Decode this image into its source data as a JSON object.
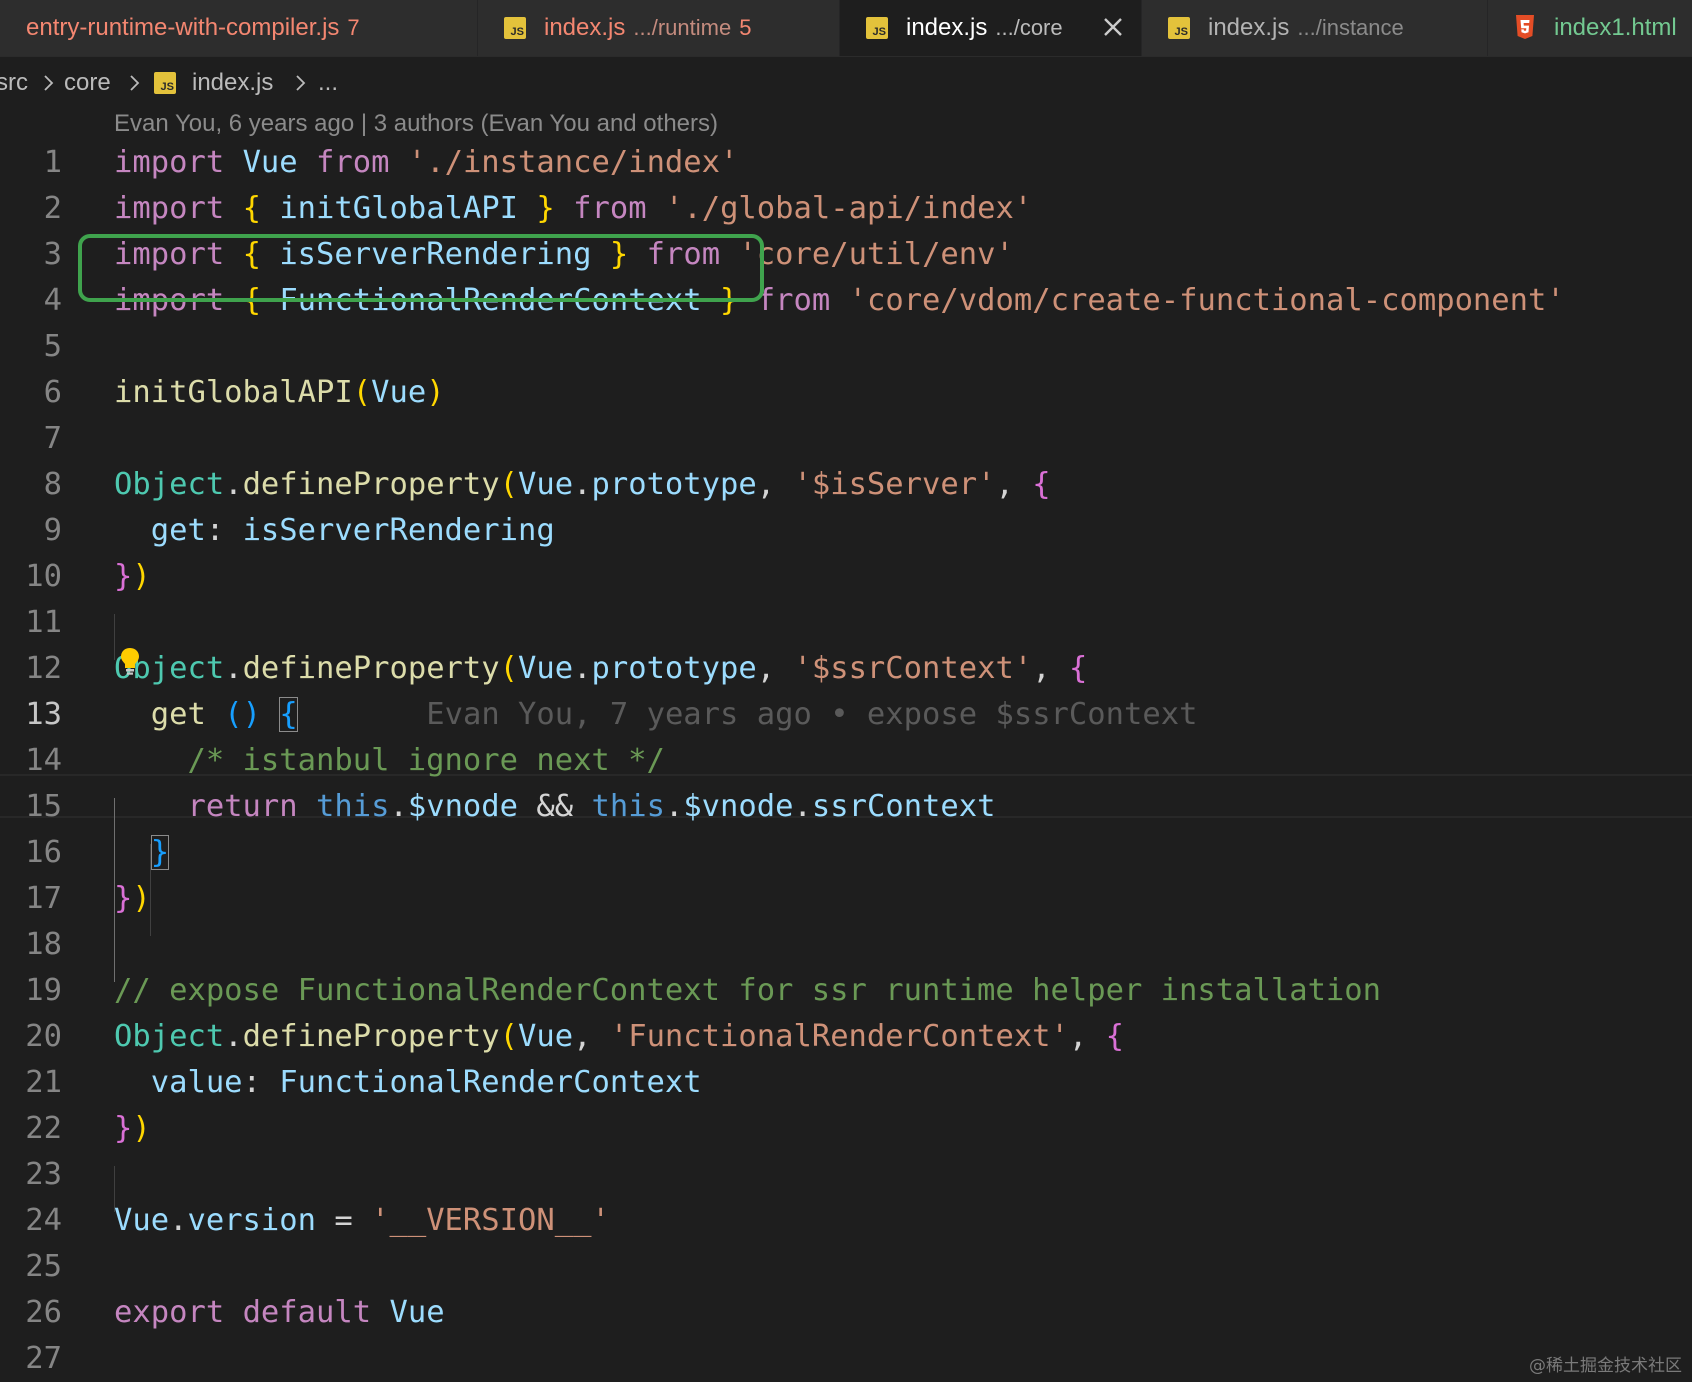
{
  "tabs": [
    {
      "label": "entry-runtime-with-compiler.js",
      "count": "7",
      "icon": "js-file-icon",
      "state": "error"
    },
    {
      "label": "index.js",
      "description": ".../runtime",
      "count": "5",
      "icon": "js-file-icon",
      "state": "error"
    },
    {
      "label": "index.js",
      "description": ".../core",
      "icon": "js-file-icon",
      "state": "active",
      "close": "close-icon"
    },
    {
      "label": "index.js",
      "description": ".../instance",
      "icon": "js-file-icon",
      "state": "normal"
    },
    {
      "label": "index1.html",
      "icon": "html5-file-icon",
      "state": "html"
    }
  ],
  "js_icon_text": "JS",
  "breadcrumb": {
    "items": [
      "src",
      "core",
      "index.js",
      "..."
    ]
  },
  "blame": {
    "top": "Evan You, 6 years ago | 3 authors (Evan You and others)",
    "inline": "Evan You, 7 years ago • expose $ssrContext"
  },
  "editor": {
    "current_line": 13,
    "line_numbers": [
      "1",
      "2",
      "3",
      "4",
      "5",
      "6",
      "7",
      "8",
      "9",
      "10",
      "11",
      "12",
      "13",
      "14",
      "15",
      "16",
      "17",
      "18",
      "19",
      "20",
      "21",
      "22",
      "23",
      "24",
      "25",
      "26",
      "27"
    ],
    "lines": [
      [
        [
          "k",
          "import"
        ],
        [
          "p",
          " "
        ],
        [
          "v",
          "Vue"
        ],
        [
          "p",
          " "
        ],
        [
          "k",
          "from"
        ],
        [
          "p",
          " "
        ],
        [
          "s",
          "'./instance/index'"
        ]
      ],
      [
        [
          "k",
          "import"
        ],
        [
          "p",
          " "
        ],
        [
          "y",
          "{"
        ],
        [
          "p",
          " "
        ],
        [
          "v",
          "initGlobalAPI"
        ],
        [
          "p",
          " "
        ],
        [
          "y",
          "}"
        ],
        [
          "p",
          " "
        ],
        [
          "k",
          "from"
        ],
        [
          "p",
          " "
        ],
        [
          "s",
          "'./global-api/index'"
        ]
      ],
      [
        [
          "k",
          "import"
        ],
        [
          "p",
          " "
        ],
        [
          "y",
          "{"
        ],
        [
          "p",
          " "
        ],
        [
          "v",
          "isServerRendering"
        ],
        [
          "p",
          " "
        ],
        [
          "y",
          "}"
        ],
        [
          "p",
          " "
        ],
        [
          "k",
          "from"
        ],
        [
          "p",
          " "
        ],
        [
          "s",
          "'core/util/env'"
        ]
      ],
      [
        [
          "k",
          "import"
        ],
        [
          "p",
          " "
        ],
        [
          "y",
          "{"
        ],
        [
          "p",
          " "
        ],
        [
          "v",
          "FunctionalRenderContext"
        ],
        [
          "p",
          " "
        ],
        [
          "y",
          "}"
        ],
        [
          "p",
          " "
        ],
        [
          "k",
          "from"
        ],
        [
          "p",
          " "
        ],
        [
          "s",
          "'core/vdom/create-functional-component'"
        ]
      ],
      [],
      [
        [
          "f",
          "initGlobalAPI"
        ],
        [
          "y",
          "("
        ],
        [
          "v",
          "Vue"
        ],
        [
          "y",
          ")"
        ]
      ],
      [],
      [
        [
          "t",
          "Object"
        ],
        [
          "p",
          "."
        ],
        [
          "f",
          "defineProperty"
        ],
        [
          "y",
          "("
        ],
        [
          "v",
          "Vue"
        ],
        [
          "p",
          "."
        ],
        [
          "v",
          "prototype"
        ],
        [
          "p",
          ", "
        ],
        [
          "s",
          "'$isServer'"
        ],
        [
          "p",
          ", "
        ],
        [
          "pk",
          "{"
        ]
      ],
      [
        [
          "p",
          "  "
        ],
        [
          "v",
          "get"
        ],
        [
          "p",
          ": "
        ],
        [
          "v",
          "isServerRendering"
        ]
      ],
      [
        [
          "pk",
          "}"
        ],
        [
          "y",
          ")"
        ]
      ],
      [],
      [
        [
          "t",
          "Object"
        ],
        [
          "p",
          "."
        ],
        [
          "f",
          "defineProperty"
        ],
        [
          "y",
          "("
        ],
        [
          "v",
          "Vue"
        ],
        [
          "p",
          "."
        ],
        [
          "v",
          "prototype"
        ],
        [
          "p",
          ", "
        ],
        [
          "s",
          "'$ssrContext'"
        ],
        [
          "p",
          ", "
        ],
        [
          "pk",
          "{"
        ]
      ],
      [
        [
          "p",
          "  "
        ],
        [
          "f",
          "get"
        ],
        [
          "p",
          " "
        ],
        [
          "bl",
          "()"
        ],
        [
          "p",
          " "
        ],
        [
          "bl",
          "{"
        ],
        [
          "p",
          "       "
        ],
        [
          "blame",
          ""
        ]
      ],
      [
        [
          "p",
          "    "
        ],
        [
          "c",
          "/* istanbul ignore next */"
        ]
      ],
      [
        [
          "p",
          "    "
        ],
        [
          "k",
          "return"
        ],
        [
          "p",
          " "
        ],
        [
          "b",
          "this"
        ],
        [
          "p",
          "."
        ],
        [
          "v",
          "$vnode"
        ],
        [
          "p",
          " && "
        ],
        [
          "b",
          "this"
        ],
        [
          "p",
          "."
        ],
        [
          "v",
          "$vnode"
        ],
        [
          "p",
          "."
        ],
        [
          "v",
          "ssrContext"
        ]
      ],
      [
        [
          "p",
          "  "
        ],
        [
          "bl",
          "}"
        ]
      ],
      [
        [
          "pk",
          "}"
        ],
        [
          "y",
          ")"
        ]
      ],
      [],
      [
        [
          "c",
          "// expose FunctionalRenderContext for ssr runtime helper installation"
        ]
      ],
      [
        [
          "t",
          "Object"
        ],
        [
          "p",
          "."
        ],
        [
          "f",
          "defineProperty"
        ],
        [
          "y",
          "("
        ],
        [
          "v",
          "Vue"
        ],
        [
          "p",
          ", "
        ],
        [
          "s",
          "'FunctionalRenderContext'"
        ],
        [
          "p",
          ", "
        ],
        [
          "pk",
          "{"
        ]
      ],
      [
        [
          "p",
          "  "
        ],
        [
          "v",
          "value"
        ],
        [
          "p",
          ": "
        ],
        [
          "v",
          "FunctionalRenderContext"
        ]
      ],
      [
        [
          "pk",
          "}"
        ],
        [
          "y",
          ")"
        ]
      ],
      [],
      [
        [
          "v",
          "Vue"
        ],
        [
          "p",
          "."
        ],
        [
          "v",
          "version"
        ],
        [
          "p",
          " = "
        ],
        [
          "s",
          "'__VERSION__'"
        ]
      ],
      [],
      [
        [
          "k",
          "export"
        ],
        [
          "p",
          " "
        ],
        [
          "k",
          "default"
        ],
        [
          "p",
          " "
        ],
        [
          "v",
          "Vue"
        ]
      ],
      []
    ]
  },
  "watermark": "@稀土掘金技术社区",
  "colors": {
    "editor_bg": "#1e1e1e",
    "highlight_box": "#3fa34d",
    "keyword": "#c586c0",
    "string": "#ce9178",
    "comment": "#6a9955",
    "function": "#dcdcaa",
    "variable": "#9cdcfe",
    "type": "#4ec9b0"
  }
}
